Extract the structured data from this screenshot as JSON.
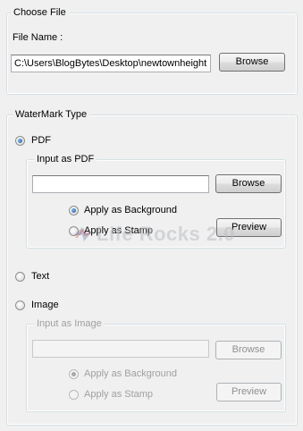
{
  "choose_file": {
    "legend": "Choose File",
    "file_name_label": "File Name :",
    "file_path_value": "C:\\Users\\BlogBytes\\Desktop\\newtownheight",
    "browse_label": "Browse"
  },
  "watermark_type": {
    "legend": "WaterMark Type",
    "pdf": {
      "label": "PDF",
      "selected": true,
      "input_group_legend": "Input as PDF",
      "input_value": "",
      "browse_label": "Browse",
      "apply_background_label": "Apply as Background",
      "apply_background_selected": true,
      "apply_stamp_label": "Apply as Stamp",
      "apply_stamp_selected": false,
      "preview_label": "Preview"
    },
    "text": {
      "label": "Text",
      "selected": false
    },
    "image": {
      "label": "Image",
      "selected": false,
      "input_group_legend": "Input as Image",
      "input_value": "",
      "browse_label": "Browse",
      "apply_background_label": "Apply as Background",
      "apply_background_selected": true,
      "apply_stamp_label": "Apply as Stamp",
      "apply_stamp_selected": false,
      "preview_label": "Preview"
    }
  },
  "watermark_overlay": {
    "text": "Life Rocks 2.0"
  }
}
